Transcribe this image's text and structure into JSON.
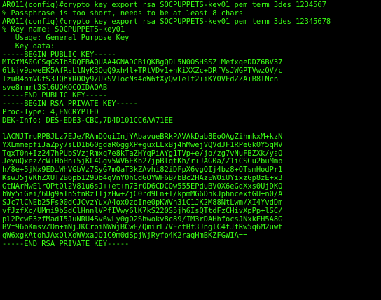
{
  "terminal": {
    "text_color": "#39ff14",
    "background": "#000000",
    "lines": [
      "AR011(config)#crypto key export rsa SOCPUPPETS-key01 pem term 3des 1234567",
      "% Passphrase is too short, needs to be at least 8 chars",
      "AR011(config)#crypto key export rsa SOCPUPPETS-key01 pem term 3des 12345678",
      "% Key name: SOCPUPPETS-key01",
      "   Usage: General Purpose Key",
      "   Key data:",
      "-----BEGIN PUBLIC KEY-----",
      "MIGfMA0GCSqGSIb3DQEBAQUAA4GNADCBiQKBgQDL5N0OSHSSZ+MefxqeDDZ6BV37",
      "6lkjv9qweEK5AfRsLlNyK3OqQ9xh4l+TRtVDv1+hKiXXZc+DRfVsJWGPTVwzOV/c",
      "TzuB4omVGfS3JQhYROOy9/UkSVTocNs4oW6tXyQwIeTf2+iKY0VFdZZA+B8lNcn",
      "sve8rmrt3Sl6UOKQCQIDAQAB",
      "-----END PUBLIC KEY-----",
      "-----BEGIN RSA PRIVATE KEY-----",
      "Proc-Type: 4,ENCRYPTED",
      "DEK-Info: DES-EDE3-CBC,7D4D101CC6AA71EE",
      "",
      "lACNJTruRPBJLz7EJe/RAmDOqiInjYAbavueBRkPAVAkDab8EoOAgZihmkxM+kzN",
      "YXLmmepfiJaZpy7sLD1b60gdaR6ggXP+guxLLxBj4hMwejVQVdJF1RPeGk0Y5qMV",
      "TqxT0n+Iz247hPUbSVzjRmxq7e8kTaZHYqPiAYg1TVp+e/jo/zg7vNuFBZXk/ysQ",
      "JeyuQxezZcW+HbHn+5jKL4Ggv5WV6EKb27jpBlqtKh/r+JAG0a/Z1iCSGu2buMmp",
      "h/8e+5jNx9EDiWhVGbVz7SyG7mQaT3kZAvhi82iDFpX6vgQIj4bz8+OTsmHodPr1",
      "KswJ5jVKhZXUT2B6pb129Db4qVnY0hCdGOYWF6B/bBc2HAzEWOiUYixzGp8zE+x3",
      "GtNArMwElrQPtOl2V81u6sJ++et+m73rOD6CDCQw555EPduBV0X6eGdXxs0UjDKQ",
      "hWy5iGei/6Ug9aInStnRzIIjzHw+ZjC0rd9Ln+I/kpmMG6DnkJphncextGU+n0/A",
      "SJc7lCNEb25Fs00dCJCvzYuxA4ox0zoIne0pKWVn3iC1JK2M88NtLwm/XI4YvdDm",
      "vfJzfXc/UMmi9bSdClHnnlVPfIVwy6lK7kS220S5jh6IsQTtdFzCHivXpPp+lSC/",
      "pl2PcwE3zfMadI5JuNRU4Sv6wLy0gO2Shwokv8c89/IM3rDAHhfocsJNxkEH5A8G",
      "BVf96bKmsvZDm+mNjJKCroiNWWjBCwE/QmirL7VEctBf3JnglC4tJfRw5q6M2uwt",
      "qW6xgkAtohJAxQlXoWVxaJQ1C0m0dSpjWjRyfo4K2raqHmBKZFGWIA==",
      "-----END RSA PRIVATE KEY-----"
    ]
  }
}
